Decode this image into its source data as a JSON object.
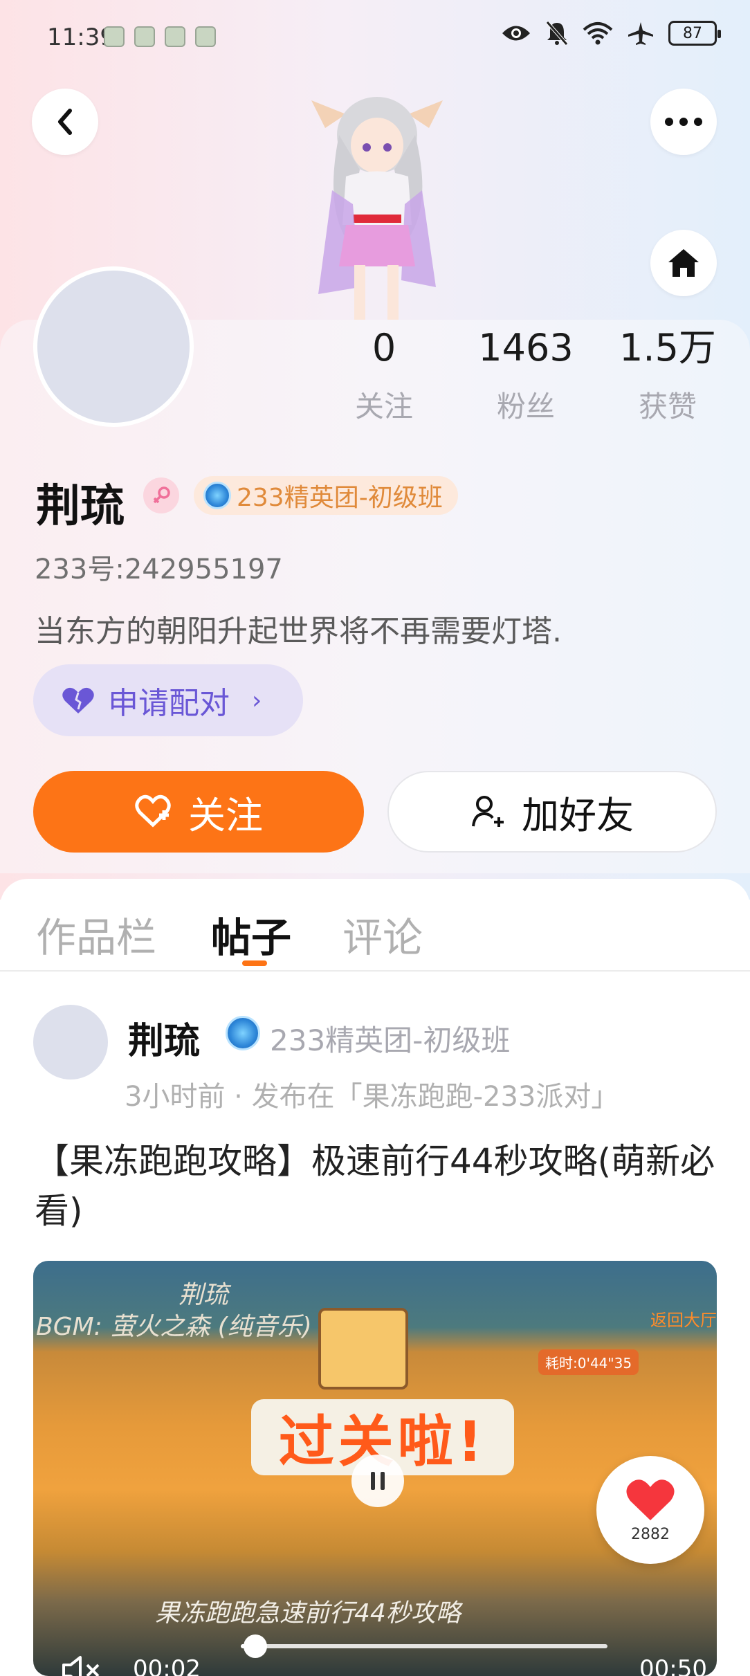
{
  "status_bar": {
    "time": "11:39",
    "battery": "87"
  },
  "profile": {
    "name": "荆琉",
    "gender_icon": "female-icon",
    "rank": "233精英团-初级班",
    "id_text": "233号:242955197",
    "bio": "当东方的朝阳升起世界将不再需要灯塔.",
    "stats": [
      {
        "value": "0",
        "label": "关注"
      },
      {
        "value": "1463",
        "label": "粉丝"
      },
      {
        "value": "1.5万",
        "label": "获赞"
      }
    ],
    "pair_button": "申请配对",
    "follow_button": "关注",
    "add_friend_button": "加好友"
  },
  "tabs": [
    "作品栏",
    "帖子",
    "评论"
  ],
  "active_tab": "帖子",
  "post": {
    "author": "荆琉",
    "rank": "233精英团-初级班",
    "meta": "3小时前 · 发布在「果冻跑跑-233派对」",
    "title": "【果冻跑跑攻略】极速前行44秒攻略(萌新必看)",
    "video": {
      "author_overlay": "荆琉",
      "bgm_overlay": "BGM: 萤火之森 (纯音乐)",
      "return_label": "返回大厅",
      "timer_label": "耗时:0'44\"35",
      "banner_text": "过关啦!",
      "caption": "果冻跑跑急速前行44秒攻略",
      "current_time": "00:02",
      "total_time": "00:50",
      "progress": 0.04
    },
    "like_count": "2882"
  },
  "colors": {
    "accent": "#fd7416",
    "pair": "#6a57d6",
    "rank_text": "#e08a3a"
  }
}
